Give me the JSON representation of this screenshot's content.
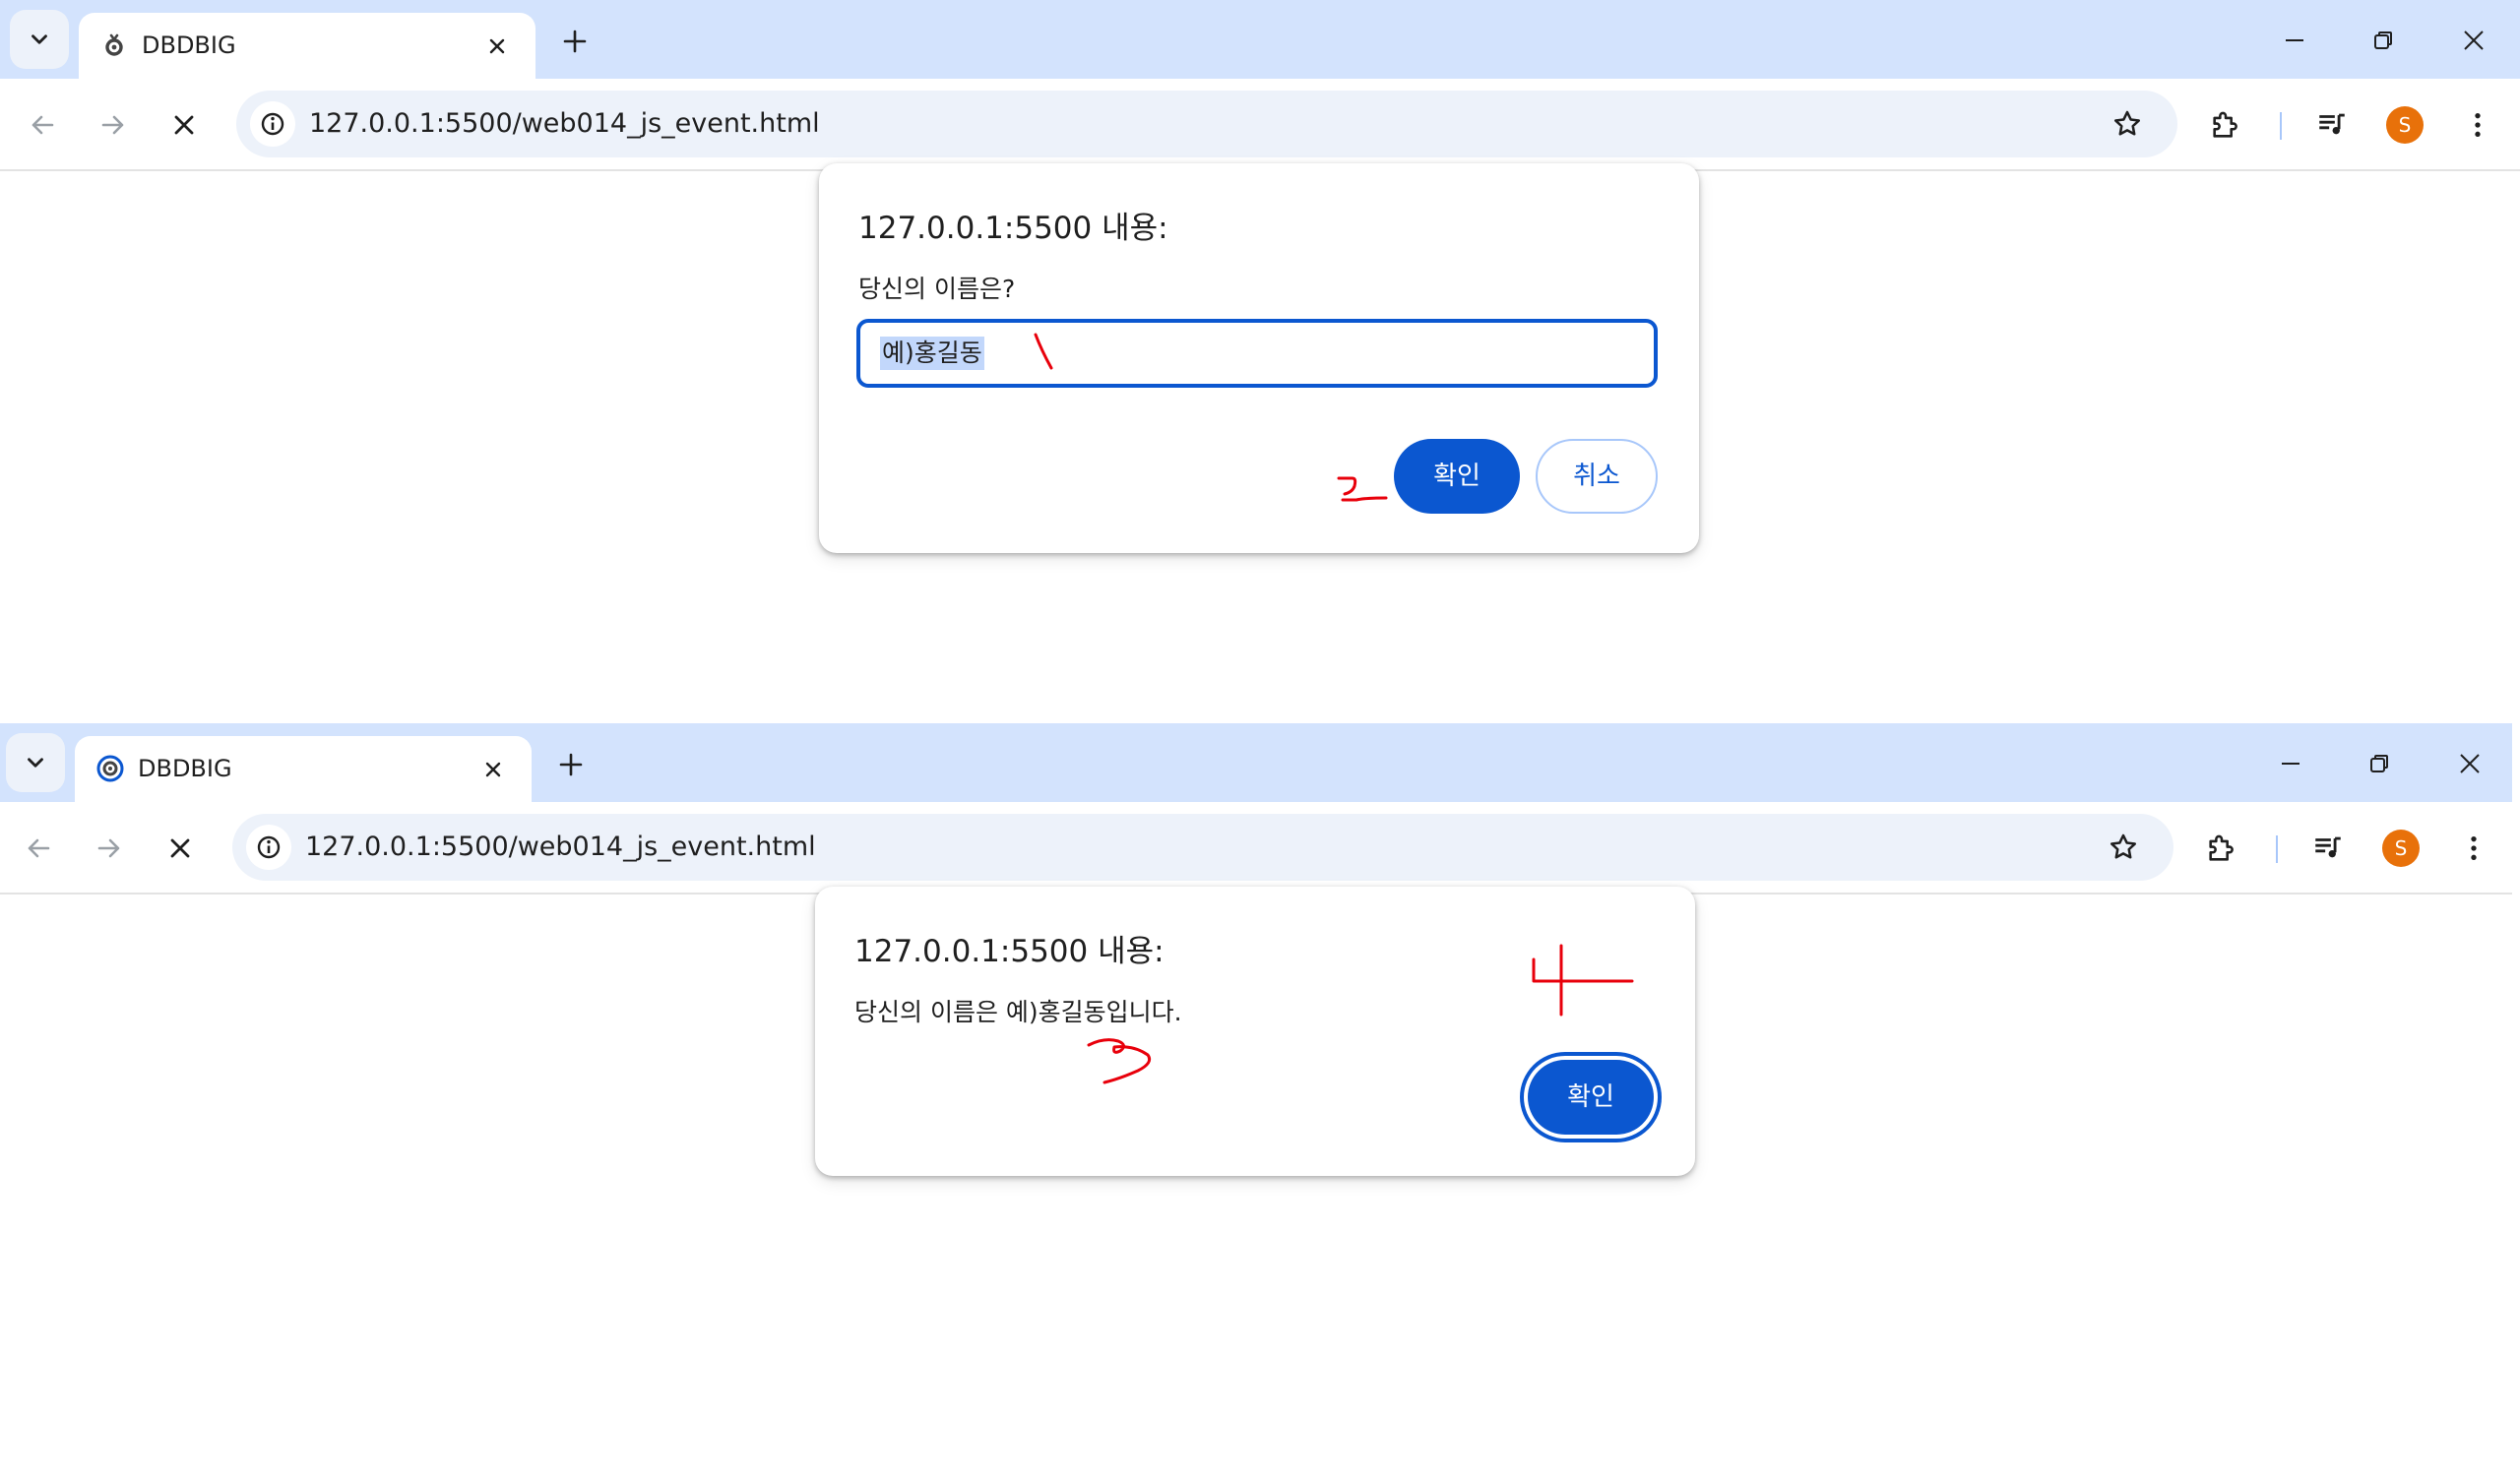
{
  "browser": {
    "tab_title": "DBDBIG",
    "url": "127.0.0.1:5500/web014_js_event.html",
    "avatar_initial": "S",
    "avatar_color": "#e8710a",
    "accent_color": "#0b57d0",
    "icons": [
      "tab-search-icon",
      "favicon-icon",
      "close-icon",
      "plus-icon",
      "minimize-icon",
      "restore-icon",
      "back-icon",
      "forward-icon",
      "stop-icon",
      "info-icon",
      "star-icon",
      "extensions-icon",
      "media-control-icon",
      "kebab-menu-icon"
    ]
  },
  "prompt_dialog": {
    "title": "127.0.0.1:5500 내용:",
    "message": "당신의 이름은?",
    "input_value": "예)홍길동",
    "ok_label": "확인",
    "cancel_label": "취소"
  },
  "alert_dialog": {
    "title": "127.0.0.1:5500 내용:",
    "message": "당신의 이름은 예)홍길동입니다.",
    "ok_label": "확인"
  },
  "annotations": {
    "color": "#e8000b",
    "marks": [
      "1",
      "2",
      "3",
      "4"
    ]
  }
}
